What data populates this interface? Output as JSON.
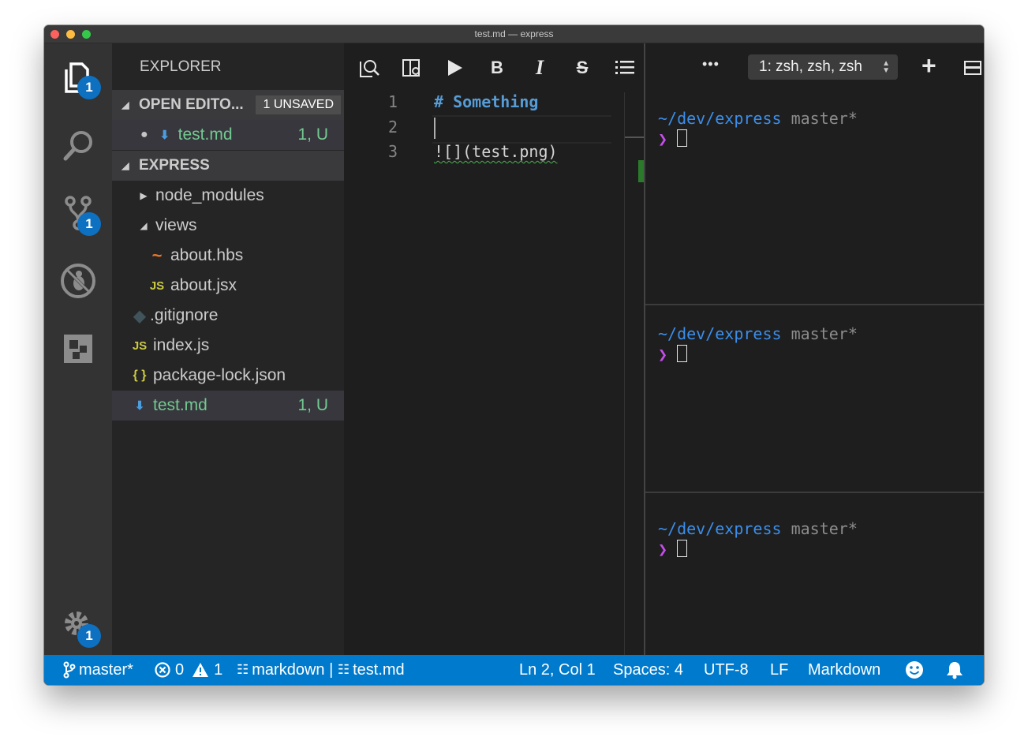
{
  "window": {
    "title": "test.md — express"
  },
  "activity": {
    "explorer_badge": "1",
    "scm_badge": "1",
    "settings_badge": "1"
  },
  "sidebar": {
    "header": "EXPLORER",
    "open_editors": {
      "title": "OPEN EDITO...",
      "unsaved_badge": "1 UNSAVED",
      "items": [
        {
          "name": "test.md",
          "status": "1, U",
          "dirty": true
        }
      ]
    },
    "project": {
      "title": "EXPRESS",
      "items": [
        {
          "name": "node_modules",
          "icon": "folder-collapsed"
        },
        {
          "name": "views",
          "icon": "folder-expanded"
        },
        {
          "name": "about.hbs",
          "icon": "handlebars-icon",
          "glyph": "~"
        },
        {
          "name": "about.jsx",
          "icon": "javascript-icon",
          "glyph": "JS"
        },
        {
          "name": ".gitignore",
          "icon": "git-icon",
          "glyph": "◆"
        },
        {
          "name": "index.js",
          "icon": "javascript-icon",
          "glyph": "JS"
        },
        {
          "name": "package-lock.json",
          "icon": "json-icon",
          "glyph": "{ }"
        },
        {
          "name": "test.md",
          "icon": "markdown-icon",
          "glyph": "⬇",
          "status": "1, U"
        }
      ]
    }
  },
  "editor": {
    "toolbar": {
      "bold": "B",
      "italic": "I",
      "strike": "S"
    },
    "lines": [
      {
        "number": "1",
        "text": "# Something"
      },
      {
        "number": "2",
        "text": ""
      },
      {
        "number": "3",
        "text": "![](test.png)"
      }
    ]
  },
  "terminal": {
    "more": "•••",
    "selector": "1: zsh, zsh, zsh",
    "add": "+",
    "panes": [
      {
        "path": "~/dev/express",
        "branch": "master*",
        "prompt": "❯"
      },
      {
        "path": "~/dev/express",
        "branch": "master*",
        "prompt": "❯"
      },
      {
        "path": "~/dev/express",
        "branch": "master*",
        "prompt": "❯"
      }
    ]
  },
  "statusbar": {
    "branch": "master*",
    "errors": "0",
    "warnings": "1",
    "mode": "markdown | ",
    "file": "test.md",
    "position": "Ln 2, Col 1",
    "spaces": "Spaces: 4",
    "encoding": "UTF-8",
    "eol": "LF",
    "language": "Markdown"
  },
  "colors": {
    "accent": "#007acc",
    "badge": "#0e70c0",
    "heading": "#569cd6",
    "git_untracked": "#73c991",
    "prompt": "#c74ded",
    "path": "#3b8eea"
  }
}
